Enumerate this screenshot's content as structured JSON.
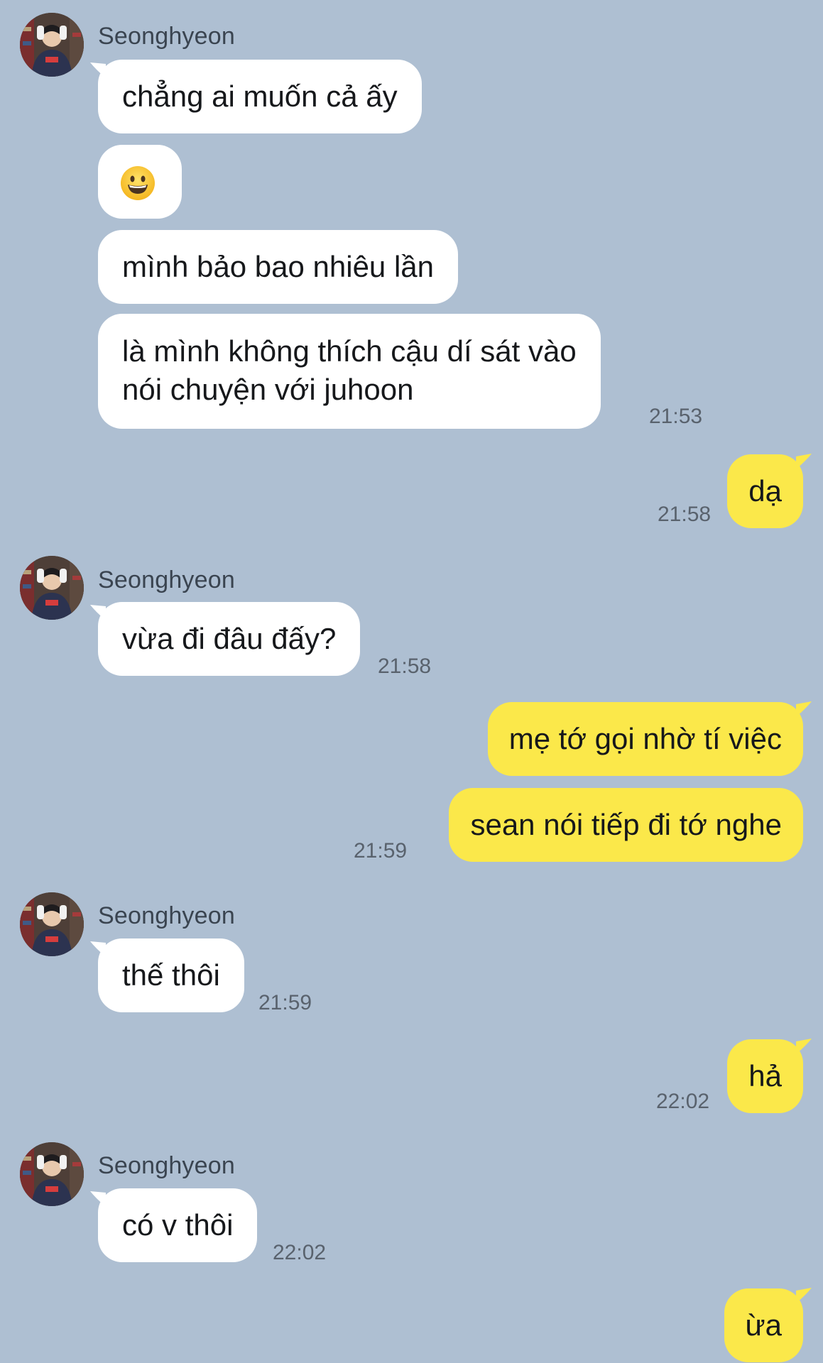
{
  "contact": {
    "name": "Seonghyeon"
  },
  "colors": {
    "background": "#aebfd2",
    "incoming_bubble": "#ffffff",
    "outgoing_bubble": "#fbe84a",
    "timestamp": "#59626d"
  },
  "icons": {
    "avatar": "profile-photo",
    "emoji": "grinning-face"
  },
  "messages": [
    {
      "from": "contact",
      "text": "chẳng ai muốn cả ấy"
    },
    {
      "from": "contact",
      "text": "😀",
      "kind": "emoji"
    },
    {
      "from": "contact",
      "text": "mình bảo bao nhiêu lần"
    },
    {
      "from": "contact",
      "lines": [
        "là mình không thích cậu dí sát vào",
        "nói chuyện với juhoon"
      ],
      "time": "21:53"
    },
    {
      "from": "me",
      "text": "dạ",
      "time": "21:58"
    },
    {
      "from": "contact",
      "text": "vừa đi đâu đấy?",
      "time": "21:58"
    },
    {
      "from": "me",
      "text": "mẹ tớ gọi nhờ tí việc"
    },
    {
      "from": "me",
      "text": "sean nói tiếp đi tớ nghe",
      "time": "21:59"
    },
    {
      "from": "contact",
      "text": "thế thôi",
      "time": "21:59"
    },
    {
      "from": "me",
      "text": "hả",
      "time": "22:02"
    },
    {
      "from": "contact",
      "text": "có v thôi",
      "time": "22:02"
    },
    {
      "from": "me",
      "text": "ừa"
    }
  ]
}
